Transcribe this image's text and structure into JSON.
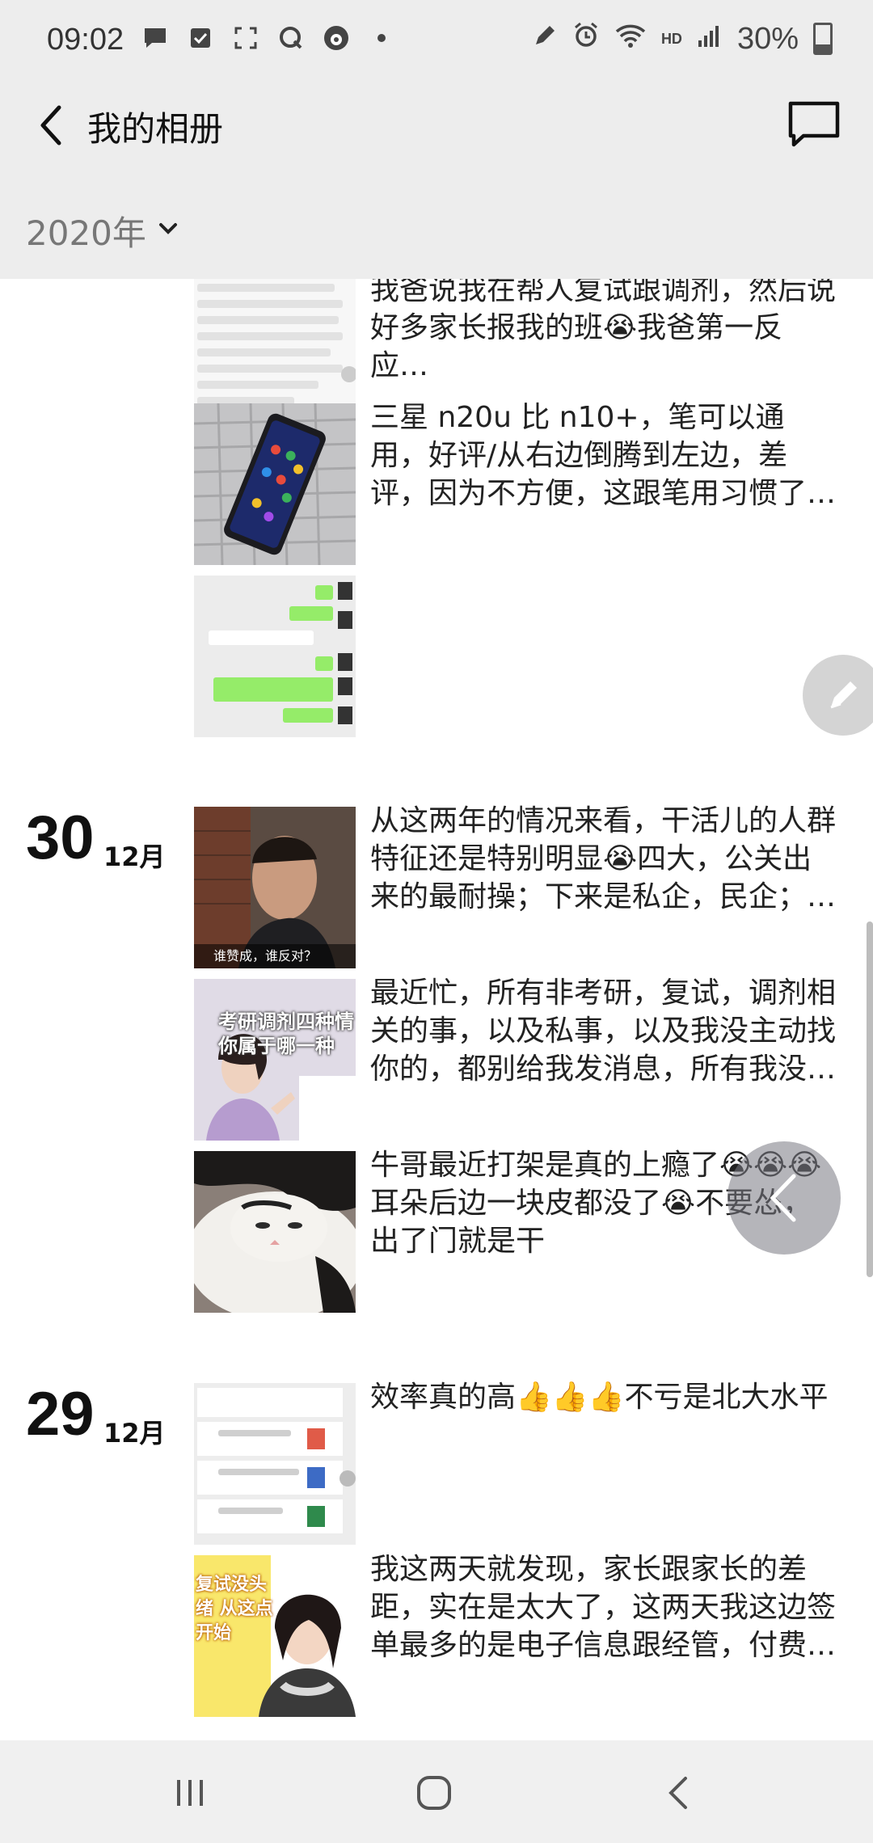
{
  "status_bar": {
    "time": "09:02",
    "network": "HD",
    "battery": "30%"
  },
  "header": {
    "title": "我的相册"
  },
  "year_filter": {
    "label": "2020年"
  },
  "groups": [
    {
      "posts": [
        {
          "text": "我爸说我在帮人复试跟调剂，然后说好多家长报我的班😭我爸第一反应…",
          "thumb_caption": ""
        },
        {
          "text": "三星 n20u 比 n10+，笔可以通用，好评/从右边倒腾到左边，差评，因为不方便，这跟笔用习惯了确实不能摆…",
          "thumb_caption": ""
        },
        {
          "text": "",
          "thumb_caption": ""
        }
      ]
    },
    {
      "day": "30",
      "month": "12月",
      "posts": [
        {
          "text": "从这两年的情况来看，干活儿的人群特征还是特别明显😭四大，公关出来的最耐操；下来是私企，民企；再…",
          "thumb_caption": "谁赞成，谁反对？"
        },
        {
          "text": "最近忙，所有非考研，复试，调剂相关的事，以及私事，以及我没主动找你的，都别给我发消息，所有我没…",
          "thumb_caption": "考研调剂四种情 你属于哪一种"
        },
        {
          "text": "牛哥最近打架是真的上瘾了😭😭😭耳朵后边一块皮都没了😭不要怂，出了门就是干",
          "thumb_caption": ""
        }
      ]
    },
    {
      "day": "29",
      "month": "12月",
      "posts": [
        {
          "text": "效率真的高👍👍👍不亏是北大水平",
          "thumb_caption": ""
        },
        {
          "text": "我这两天就发现，家长跟家长的差距，实在是太大了，这两天我这边签单最多的是电子信息跟经管，付费意愿高…",
          "thumb_caption": "复试没头绪 从这点开始"
        }
      ]
    }
  ],
  "icons": [
    "chat-bubble-icon",
    "checkbox-icon",
    "screenshot-icon",
    "quik-icon",
    "weibo-icon",
    "dot-icon",
    "pen-icon",
    "alarm-icon",
    "wifi-icon",
    "signal-icon",
    "battery-icon",
    "back-arrow-icon",
    "message-icon",
    "chevron-down-icon",
    "edit-pencil-icon",
    "recents-icon",
    "home-icon",
    "nav-back-icon"
  ],
  "colors": {
    "header_bg": "#ededed",
    "text": "#222222",
    "fab": "#d4d4d4"
  }
}
